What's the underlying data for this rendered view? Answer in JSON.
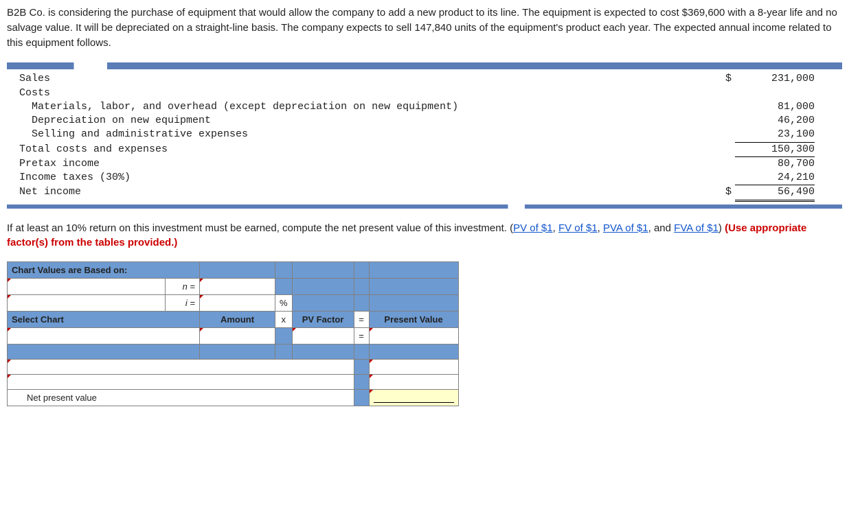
{
  "problem_text": "B2B Co. is considering the purchase of equipment that would allow the company to add a new product to its line. The equipment is expected to cost $369,600 with a 8-year life and no salvage value. It will be depreciated on a straight-line basis. The company expects to sell 147,840 units of the equipment's product each year. The expected annual income related to this equipment follows.",
  "income_statement": {
    "sales_label": "Sales",
    "sales_amount": "231,000",
    "costs_label": "Costs",
    "line_materials": "Materials, labor, and overhead (except depreciation on new equipment)",
    "amt_materials": "81,000",
    "line_dep": "Depreciation on new equipment",
    "amt_dep": "46,200",
    "line_selling": "Selling and administrative expenses",
    "amt_selling": "23,100",
    "line_total": "Total costs and expenses",
    "amt_total": "150,300",
    "line_pretax": "Pretax income",
    "amt_pretax": "80,700",
    "line_tax": "Income taxes (30%)",
    "amt_tax": "24,210",
    "line_net": "Net income",
    "amt_net": "56,490"
  },
  "instruction": {
    "lead": "If at least an 10% return on this investment must be earned, compute the net present value of this investment. (",
    "link_pv": "PV of $1",
    "sep1": ", ",
    "link_fv": "FV of $1",
    "sep2": ", ",
    "link_pva": "PVA of $1",
    "sep3": ", and ",
    "link_fva": "FVA of $1",
    "close": ") ",
    "emph": "(Use appropriate factor(s) from the tables provided.)"
  },
  "answer": {
    "chart_values_label": "Chart Values are Based on:",
    "n_label": "n =",
    "i_label": "i =",
    "pct": "%",
    "select_chart": "Select Chart",
    "amount": "Amount",
    "x": "x",
    "pv_factor": "PV Factor",
    "eq": "=",
    "present_value": "Present Value",
    "npv_label": "Net present value"
  }
}
